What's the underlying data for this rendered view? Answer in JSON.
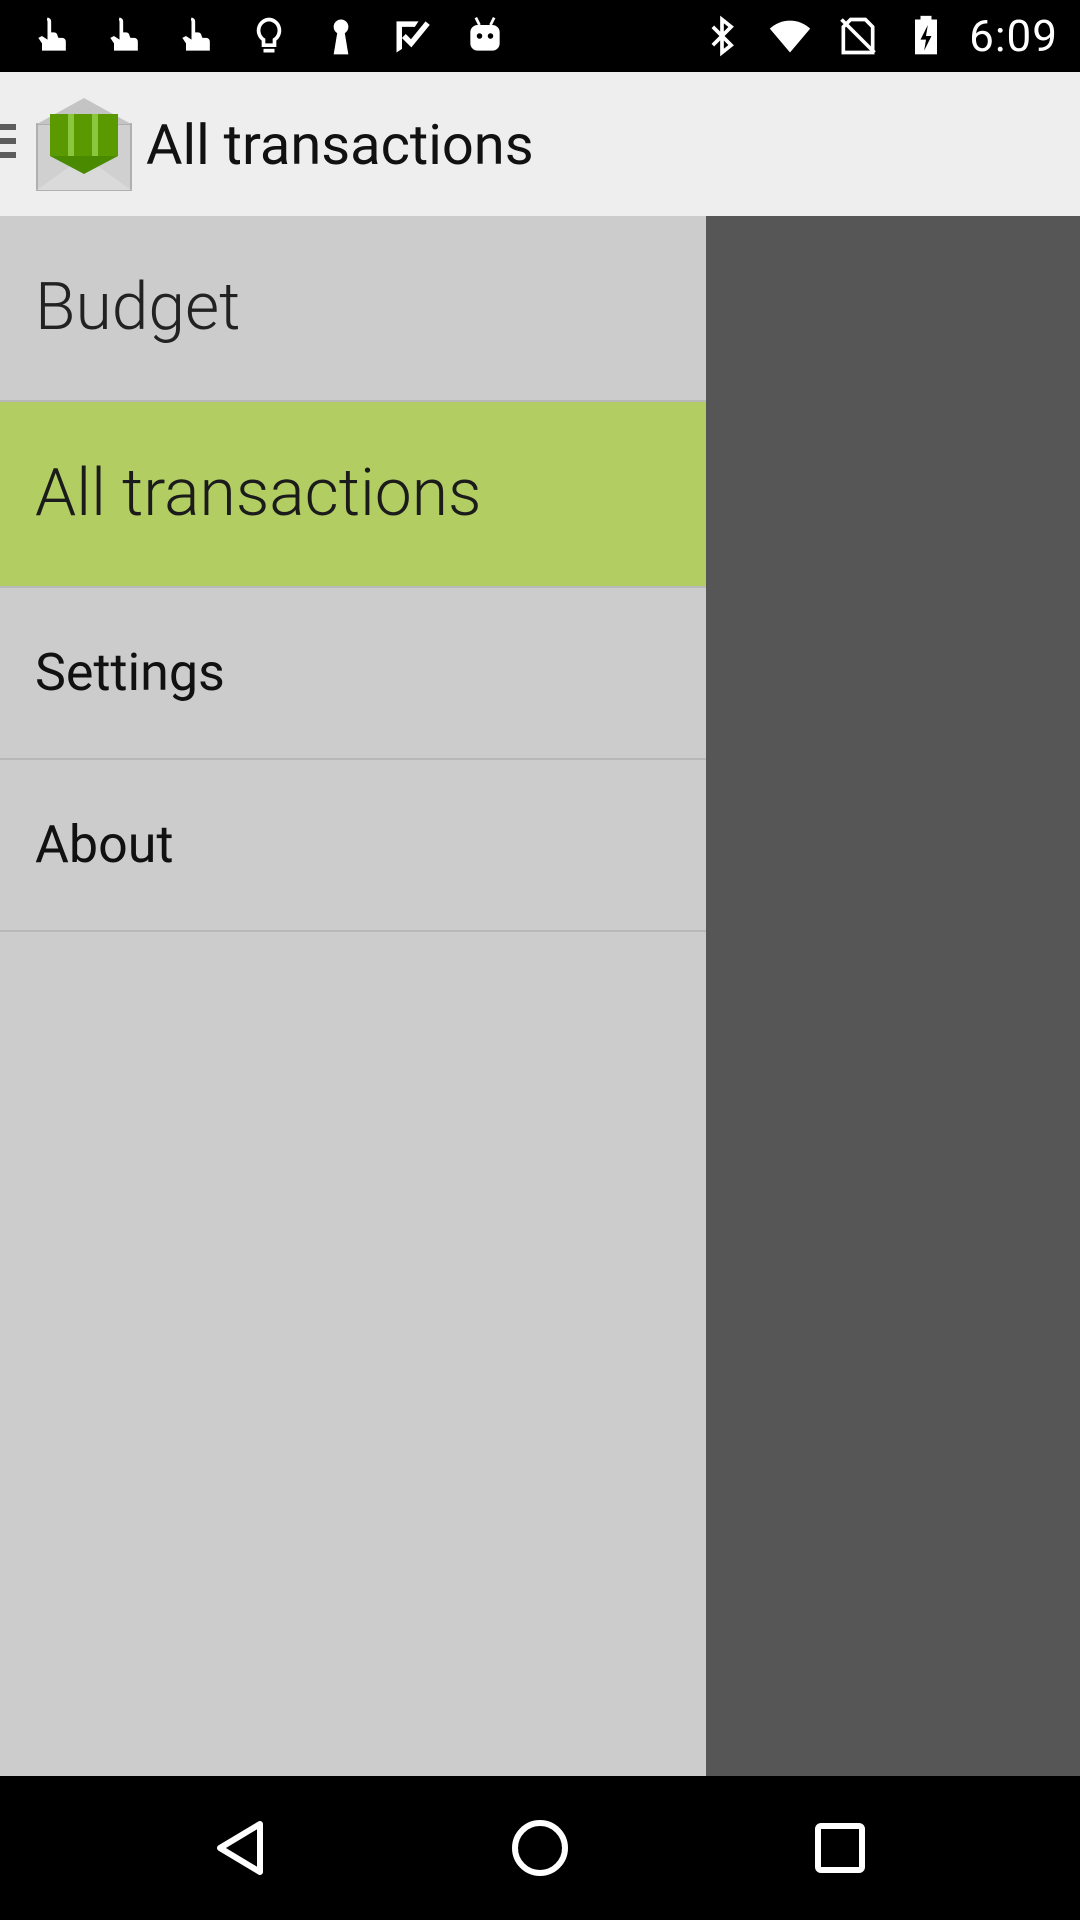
{
  "status_bar": {
    "time": "6:09",
    "left_icons": [
      "touch-icon",
      "touch-icon",
      "touch-icon",
      "lightbulb-icon",
      "keyhole-icon",
      "checkmark-icon",
      "android-icon"
    ],
    "right_icons": [
      "bluetooth-icon",
      "wifi-icon",
      "no-sim-icon",
      "battery-charging-icon"
    ]
  },
  "app_bar": {
    "title": "All transactions"
  },
  "drawer": {
    "items": [
      {
        "label": "Budget",
        "selected": false
      },
      {
        "label": "All transactions",
        "selected": true
      },
      {
        "label": "Settings",
        "selected": false
      },
      {
        "label": "About",
        "selected": false
      }
    ]
  },
  "colors": {
    "selected_item": "#b2cd62",
    "drawer_bg": "#cccccc",
    "scrim": "#565656",
    "app_bar": "#eeeeee",
    "logo_green": "#5a9a00"
  }
}
